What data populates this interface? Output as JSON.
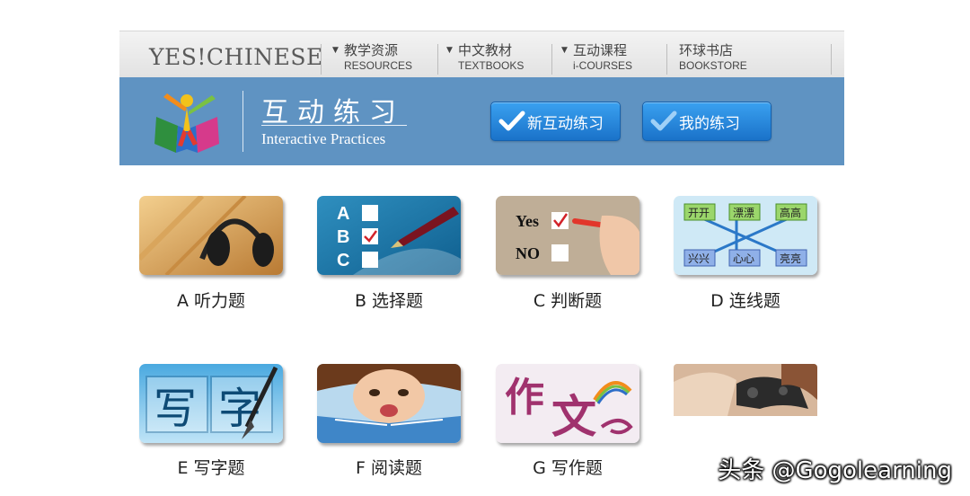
{
  "nav": {
    "brand": "YES!CHINESE",
    "items": [
      {
        "zh": "教学资源",
        "en": "RESOURCES",
        "dropdown": true
      },
      {
        "zh": "中文教材",
        "en": "TEXTBOOKS",
        "dropdown": true
      },
      {
        "zh": "互动课程",
        "en": "i-COURSES",
        "dropdown": true
      },
      {
        "zh": "环球书店",
        "en": "BOOKSTORE",
        "dropdown": false
      }
    ]
  },
  "banner": {
    "title_zh": "互动练习",
    "title_en": "Interactive Practices",
    "btn_new": "新互动练习",
    "btn_mine": "我的练习"
  },
  "tiles": [
    {
      "label": "A 听力题",
      "icon": "headphones-icon"
    },
    {
      "label": "B 选择题",
      "icon": "multiple-choice-icon",
      "text": {
        "a": "A",
        "b": "B",
        "c": "C"
      }
    },
    {
      "label": "C 判断题",
      "icon": "true-false-icon",
      "text": {
        "yes": "Yes",
        "no": "NO"
      }
    },
    {
      "label": "D 连线题",
      "icon": "matching-icon",
      "text": {
        "w1": "开开",
        "w2": "漂漂",
        "w3": "高高",
        "w4": "兴兴",
        "w5": "心心",
        "w6": "亮亮"
      }
    },
    {
      "label": "E 写字题",
      "icon": "writing-icon",
      "text": {
        "c1": "写",
        "c2": "字"
      }
    },
    {
      "label": "F 阅读题",
      "icon": "reading-icon"
    },
    {
      "label": "G 写作题",
      "icon": "composition-icon",
      "text": {
        "c1": "作",
        "c2": "文"
      }
    },
    {
      "label": "",
      "icon": "game-controller-icon"
    }
  ],
  "watermark": "头条 @Gogolearning",
  "colors": {
    "banner": "#5f93c2",
    "button": "#2a8ae0",
    "nav_bg": "#e8e8e8"
  }
}
